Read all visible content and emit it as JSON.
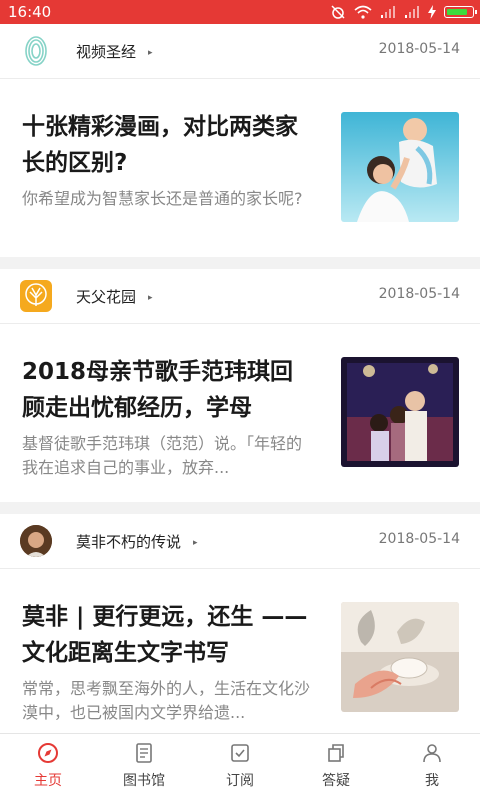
{
  "status_bar": {
    "time": "16:40"
  },
  "feed": [
    {
      "author": "视频圣经",
      "date": "2018-05-14",
      "title": "十张精彩漫画，对比两类家长的区别?",
      "summary": "你希望成为智慧家长还是普通的家长呢?"
    },
    {
      "author": "天父花园",
      "date": "2018-05-14",
      "title": "2018母亲节歌手范玮琪回顾走出忧郁经历，学母",
      "summary": "基督徒歌手范玮琪（范范）说。｢年轻的我在追求自己的事业，放弃..."
    },
    {
      "author": "莫非不朽的传说",
      "date": "2018-05-14",
      "title": "莫非 | 更行更远，还生 ——文化距离生文字书写",
      "summary": "常常，思考飘至海外的人，生活在文化沙漠中，也已被国内文学界给遗..."
    }
  ],
  "tab_bar": {
    "items": [
      {
        "label": "主页",
        "icon": "compass-icon",
        "active": true
      },
      {
        "label": "图书馆",
        "icon": "book-icon"
      },
      {
        "label": "订阅",
        "icon": "subscribe-check-icon"
      },
      {
        "label": "答疑",
        "icon": "copy-icon"
      },
      {
        "label": "我",
        "icon": "person-icon"
      }
    ]
  },
  "colors": {
    "accent": "#e53935",
    "battery": "#3ddc3d"
  }
}
